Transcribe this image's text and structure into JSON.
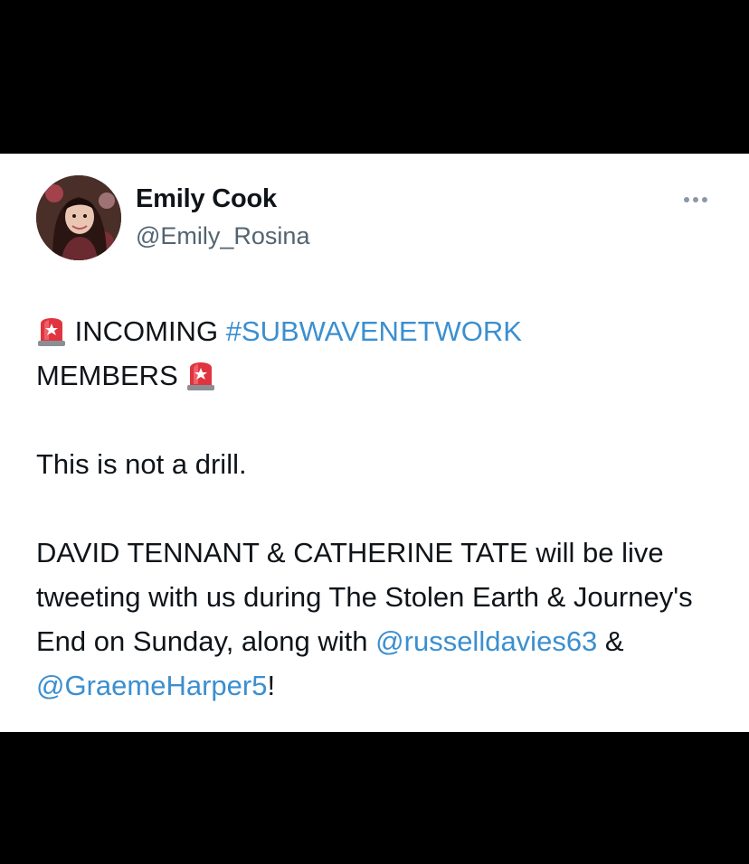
{
  "tweet": {
    "author": {
      "name": "Emily Cook",
      "handle": "@Emily_Rosina"
    },
    "more_icon": "more-horizontal-icon",
    "siren_icon": "police-car-light-emoji",
    "body": {
      "line1_text": "INCOMING",
      "hashtag": "#SUBWAVENETWORK",
      "line2_text": "MEMBERS",
      "paragraph2": "This is not a drill.",
      "paragraph3_text": "DAVID TENNANT & CATHERINE TATE will be live tweeting with us during The Stolen Earth & Journey's End on Sunday, along with",
      "mention1": "@russelldavies63",
      "and_text": "&",
      "mention2": "@GraemeHarper5",
      "ending": "!"
    }
  },
  "colors": {
    "background": "#000000",
    "card": "#ffffff",
    "text": "#0f1419",
    "handle": "#536471",
    "link": "#3b8fd0"
  }
}
